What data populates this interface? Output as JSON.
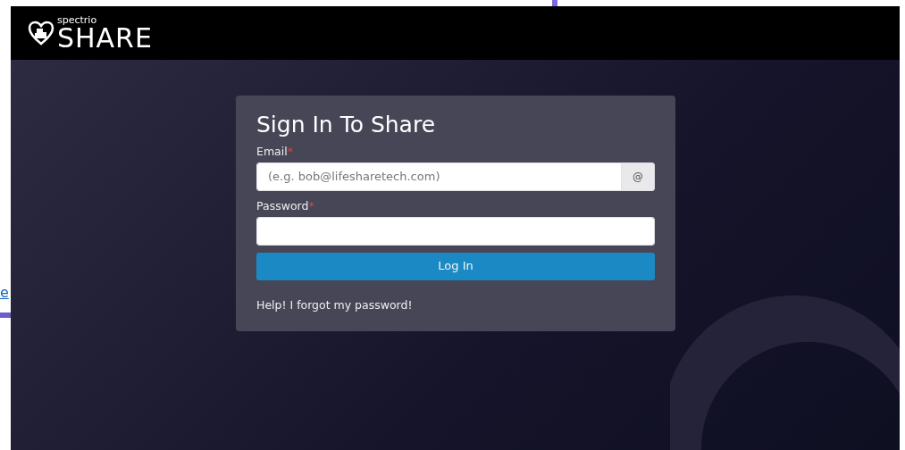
{
  "link_fragment": "e",
  "header": {
    "logo_small": "spectrio",
    "logo_big": "SHARE"
  },
  "login": {
    "title": "Sign In To Share",
    "fields": [
      {
        "label": "Email",
        "required_mark": "*",
        "placeholder": "(e.g. bob@lifesharetech.com)",
        "addon": "@"
      },
      {
        "label": "Password",
        "required_mark": "*"
      }
    ],
    "submit": "Log In",
    "forgot_link": "Help! I forgot my password!"
  }
}
